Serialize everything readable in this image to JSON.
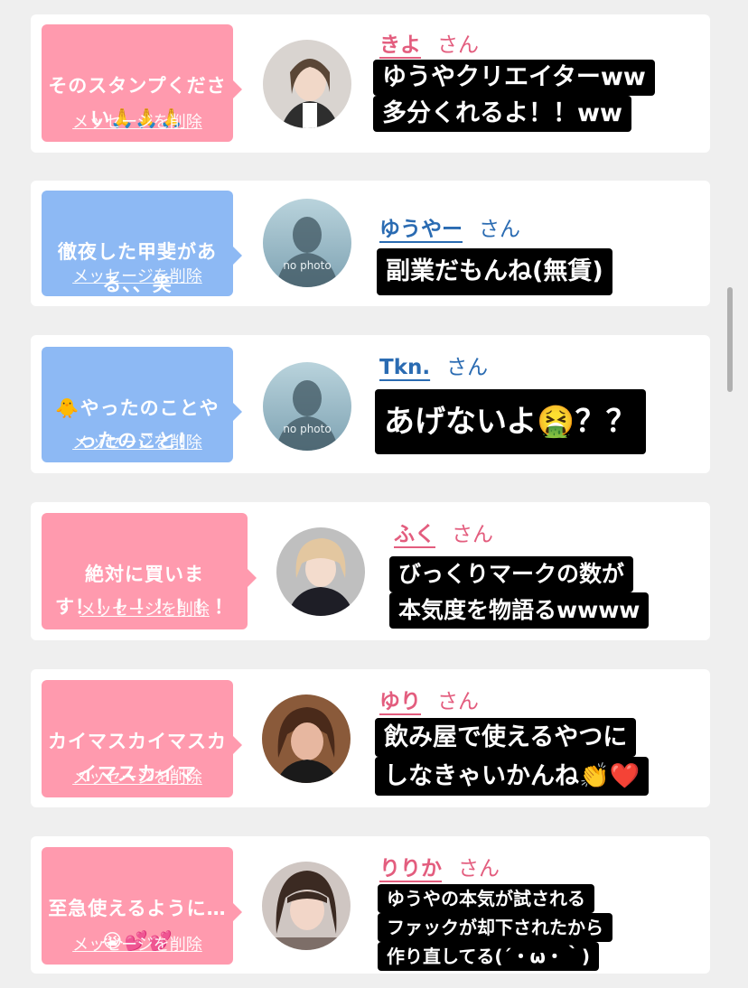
{
  "delete_label": "メッセージを削除",
  "honorific": "さん",
  "colors": {
    "pink_bubble": "#ff9aae",
    "blue_bubble": "#8db9f4",
    "pink_name": "#e35d7e",
    "blue_name": "#2a6bb2",
    "comment_bg": "#000000"
  },
  "messages": [
    {
      "bubble_text": "そのスタンプください🙏🙏🙏",
      "name": "きよ",
      "comment_lines": [
        "ゆうやクリエイターww",
        "多分くれるよ！！ww"
      ],
      "avatar_icon": "user-photo"
    },
    {
      "bubble_text": "徹夜した甲斐がある、、笑",
      "name": "ゆうやー",
      "comment_lines": [
        "副業だもんね(無賃)"
      ],
      "avatar_icon": "no-photo-placeholder",
      "avatar_text": "no photo"
    },
    {
      "bubble_text": "🐥やったのことやったのこと！",
      "name": "Tkn.",
      "comment_lines": [
        "あげないよ🤮？？"
      ],
      "avatar_icon": "no-photo-placeholder",
      "avatar_text": "no photo"
    },
    {
      "bubble_text": "絶対に買います！！！！！！！！",
      "name": "ふく",
      "comment_lines": [
        "びっくりマークの数が",
        "本気度を物語るwwww"
      ],
      "avatar_icon": "user-photo"
    },
    {
      "bubble_text": "カイマスカイマスカイマスカイマ",
      "name": "ゆり",
      "comment_lines": [
        "飲み屋で使えるやつに",
        "しなきゃいかんね👏❤️"
      ],
      "avatar_icon": "user-photo"
    },
    {
      "bubble_text": "至急使えるように…😭💕💕",
      "name": "りりか",
      "comment_lines": [
        "ゆうやの本気が試される",
        "ファックが却下されたから",
        "作り直してる(´・ω・｀)"
      ],
      "avatar_icon": "user-photo"
    }
  ]
}
